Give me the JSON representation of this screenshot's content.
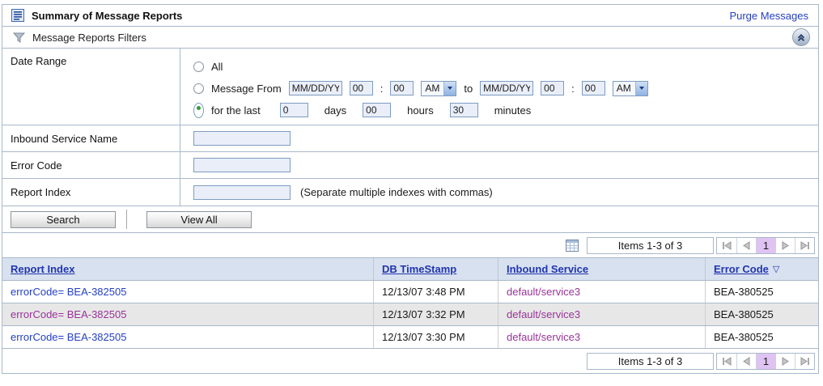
{
  "header": {
    "title": "Summary of Message Reports",
    "purge_link": "Purge Messages"
  },
  "filter_bar": {
    "title": "Message Reports Filters"
  },
  "filters": {
    "date_range": {
      "label": "Date Range",
      "all_option": "All",
      "message_from_option": "Message From",
      "from": {
        "date": "MM/DD/YY",
        "hour": "00",
        "separator": ":",
        "minute": "00",
        "ampm": "AM"
      },
      "to_label": "to",
      "to": {
        "date": "MM/DD/YY",
        "hour": "00",
        "separator": ":",
        "minute": "00",
        "ampm": "AM"
      },
      "last_option": "for the last",
      "last": {
        "days": "0",
        "days_label": "days",
        "hours": "00",
        "hours_label": "hours",
        "minutes": "30",
        "minutes_label": "minutes"
      }
    },
    "inbound_service": {
      "label": "Inbound Service Name",
      "value": ""
    },
    "error_code": {
      "label": "Error Code",
      "value": ""
    },
    "report_index": {
      "label": "Report Index",
      "value": "",
      "hint": "(Separate multiple indexes with commas)"
    },
    "search_button": "Search",
    "view_all_button": "View All"
  },
  "pagination": {
    "items_text": "Items 1-3 of 3",
    "current_page": "1"
  },
  "table": {
    "columns": {
      "report_index": "Report Index",
      "db_timestamp": "DB TimeStamp",
      "inbound_service": "Inbound Service",
      "error_code": "Error Code"
    },
    "sort": {
      "column": "Error Code",
      "direction": "descending",
      "glyph": "▽"
    },
    "rows": [
      {
        "report_index": "errorCode= BEA-382505",
        "db_timestamp": "12/13/07 3:48 PM",
        "inbound_service": "default/service3",
        "error_code": "BEA-380525"
      },
      {
        "report_index": "errorCode= BEA-382505",
        "db_timestamp": "12/13/07 3:32 PM",
        "inbound_service": "default/service3",
        "error_code": "BEA-380525"
      },
      {
        "report_index": "errorCode= BEA-382505",
        "db_timestamp": "12/13/07 3:30 PM",
        "inbound_service": "default/service3",
        "error_code": "BEA-380525"
      }
    ]
  },
  "colors": {
    "link_blue": "#2440c4",
    "visited_purple": "#993399",
    "header_link_blue": "#2135b0",
    "table_header_bg": "#d8e1ef",
    "alt_row_bg": "#e7e7e7",
    "current_page_bg": "#dfc3f2",
    "input_bg": "#e9eef9",
    "input_border": "#7d9cc0",
    "panel_border": "#a9b8ca",
    "selected_radio_green": "#2e9e38"
  }
}
